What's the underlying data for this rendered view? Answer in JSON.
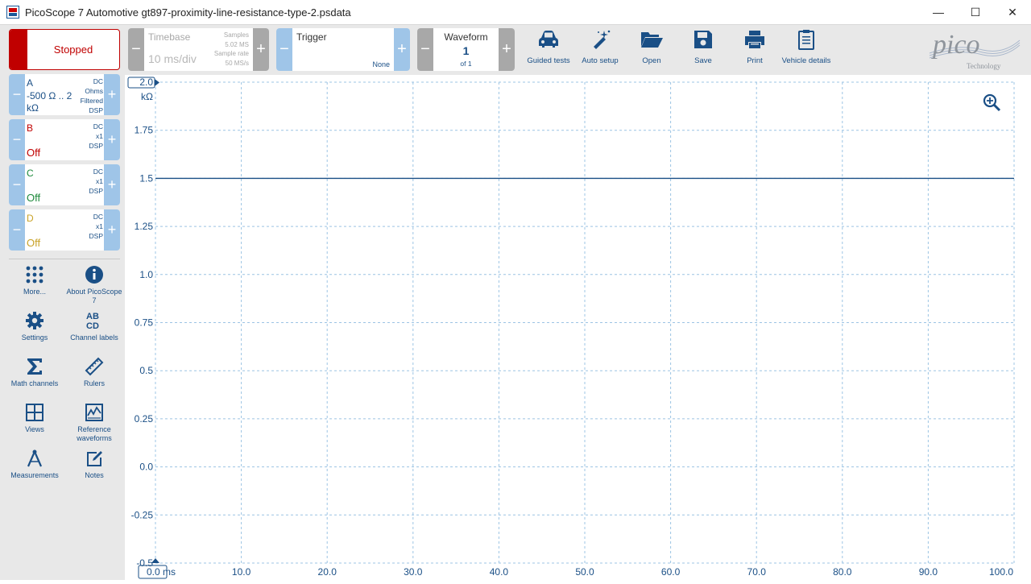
{
  "window": {
    "title": "PicoScope 7 Automotive gt897-proximity-line-resistance-type-2.psdata",
    "minimize": "—",
    "maximize": "☐",
    "close": "✕"
  },
  "run_state": {
    "label": "Stopped",
    "color": "#c00000"
  },
  "timebase": {
    "label": "Timebase",
    "value": "10 ms/div",
    "samples_label": "Samples",
    "samples_value": "5.02 MS",
    "rate_label": "Sample rate",
    "rate_value": "50 MS/s"
  },
  "trigger": {
    "label": "Trigger",
    "mode": "None"
  },
  "waveform": {
    "label": "Waveform",
    "index": "1",
    "of": "of 1"
  },
  "tools": [
    {
      "label": "Guided tests",
      "icon": "car-icon"
    },
    {
      "label": "Auto setup",
      "icon": "magic-wand-icon"
    },
    {
      "label": "Open",
      "icon": "folder-open-icon"
    },
    {
      "label": "Save",
      "icon": "floppy-icon"
    },
    {
      "label": "Print",
      "icon": "printer-icon"
    },
    {
      "label": "Vehicle details",
      "icon": "clipboard-icon"
    }
  ],
  "logo": {
    "main": "pico",
    "sub": "Technology"
  },
  "channels": [
    {
      "name": "A",
      "range": "-500 Ω .. 2 kΩ",
      "info": [
        "DC",
        "Ohms",
        "Filtered",
        "DSP"
      ],
      "color": "#1a4f86"
    },
    {
      "name": "B",
      "range": "Off",
      "info": [
        "DC",
        "x1",
        "DSP"
      ],
      "color": "#c00000"
    },
    {
      "name": "C",
      "range": "Off",
      "info": [
        "DC",
        "x1",
        "DSP"
      ],
      "color": "#1e8a3c"
    },
    {
      "name": "D",
      "range": "Off",
      "info": [
        "DC",
        "x1",
        "DSP"
      ],
      "color": "#c9a227"
    }
  ],
  "side_tools": [
    {
      "label": "More...",
      "icon": "grid-dots-icon"
    },
    {
      "label": "About PicoScope 7",
      "icon": "info-icon"
    },
    {
      "label": "Settings",
      "icon": "gear-icon"
    },
    {
      "label": "Channel labels",
      "icon": "abcd-icon"
    },
    {
      "label": "Math channels",
      "icon": "sigma-icon"
    },
    {
      "label": "Rulers",
      "icon": "ruler-icon"
    },
    {
      "label": "Views",
      "icon": "views-grid-icon"
    },
    {
      "label": "Reference waveforms",
      "icon": "reference-waveform-icon"
    },
    {
      "label": "Measurements",
      "icon": "compass-icon"
    },
    {
      "label": "Notes",
      "icon": "notes-icon"
    }
  ],
  "chart_data": {
    "type": "line",
    "y_unit": "kΩ",
    "y_ticks": [
      "2.0",
      "1.75",
      "1.5",
      "1.25",
      "1.0",
      "0.75",
      "0.5",
      "0.25",
      "0.0",
      "-0.25",
      "-0.5"
    ],
    "x_ticks": [
      "0.0 ms",
      "10.0",
      "20.0",
      "30.0",
      "40.0",
      "50.0",
      "60.0",
      "70.0",
      "80.0",
      "90.0",
      "100.0"
    ],
    "ylim": [
      -0.5,
      2.0
    ],
    "xlim": [
      0,
      100
    ],
    "grid": true,
    "series": [
      {
        "x": [
          0,
          100
        ],
        "y": [
          1.5,
          1.5
        ],
        "color": "#1a4f86"
      }
    ],
    "zoom_icon": "zoom-in-icon"
  }
}
